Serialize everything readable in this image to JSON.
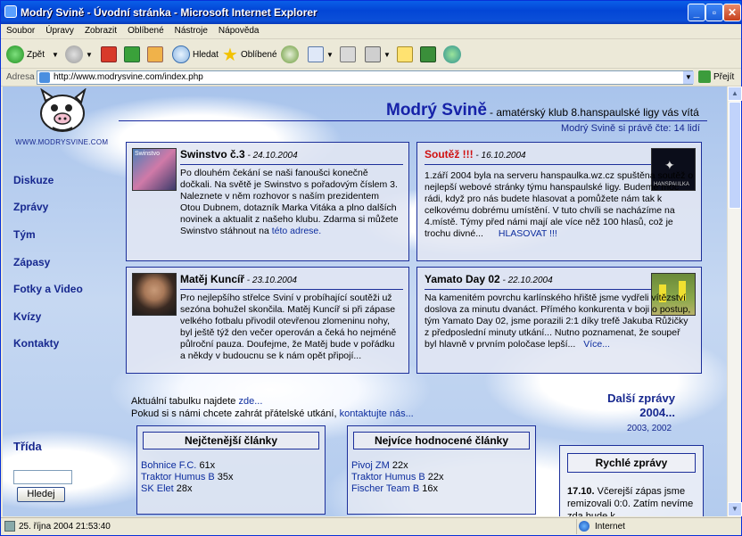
{
  "window": {
    "title": "Modrý Svině - Úvodní stránka - Microsoft Internet Explorer"
  },
  "menu": [
    "Soubor",
    "Úpravy",
    "Zobrazit",
    "Oblíbené",
    "Nástroje",
    "Nápověda"
  ],
  "toolbar": {
    "back": "Zpět",
    "search": "Hledat",
    "favorites": "Oblíbené"
  },
  "address": {
    "label": "Adresa",
    "url": "http://www.modrysvine.com/index.php",
    "go": "Přejít"
  },
  "site": {
    "logo_text": "WWW.MODRYSVINE.COM",
    "title": "Modrý Svině",
    "subtitle": "- amatérský klub 8.hanspaulské ligy vás vítá",
    "reading": "Modrý Svině si právě čte: 14 lidí"
  },
  "nav": [
    "Diskuze",
    "Zprávy",
    "Tým",
    "Zápasy",
    "Fotky a Video",
    "Kvízy",
    "Kontakty"
  ],
  "articles": [
    {
      "title": "Swinstvo č.3",
      "date": " - 24.10.2004",
      "body": "Po dlouhém čekání se naši fanoušci konečně dočkali. Na světě je Swinstvo s pořadovým číslem 3. Naleznete v něm rozhovor s naším prezidentem Otou Dubnem, dotazník Marka Vitáka a plno dalších novinek a aktualit z našeho klubu. Zdarma si můžete Swinstvo stáhnout na",
      "link": "této adrese."
    },
    {
      "title": "Soutěž !!!",
      "date": " - 16.10.2004",
      "body": "1.září 2004 byla na serveru hanspaulka.wz.cz spuštěna soutěž o nejlepší webové stránky týmu hanspaulské ligy. Budeme moc rádi, když pro nás budete hlasovat a pomůžete nám tak k celkovému dobrému umístění. V tuto chvíli se nacházíme na 4.místě. Týmy před námi mají ale více něž 100 hlasů, což je trochu divné...",
      "link": "HLASOVAT !!!"
    },
    {
      "title": "Matěj Kuncíř",
      "date": " - 23.10.2004",
      "body": "Pro nejlepšího střelce Sviní v probíhající soutěži už sezóna bohužel skončila. Matěj Kuncíř si při zápase velkého fotbalu přivodil otevřenou zlomeninu nohy, byl ještě týž den večer operován a čeká ho nejméně půlroční pauza. Doufejme, že Matěj bude v pořádku a někdy v budoucnu se k nám opět připojí...",
      "link": ""
    },
    {
      "title": "Yamato Day 02",
      "date": " - 22.10.2004",
      "body": "Na kamenitém povrchu karlínského hřiště jsme vydřeli vítězství doslova za minutu dvanáct. Přímého konkurenta v boji o postup, tým Yamato Day 02, jsme porazili 2:1 díky trefě Jakuba Růžičky z předposlední minuty utkání... Nutno poznamenat, že soupeř byl hlavně v prvním poločase lepší...",
      "link": "Více..."
    }
  ],
  "thumb_captions": {
    "swinstvo": "Swinstvo",
    "hanspaulka": "HANSPAULKA"
  },
  "middle": {
    "line1_text": "Aktuální tabulku najdete",
    "line1_link": "zde...",
    "line2_text": "Pokud si s námi chcete zahrát přátelské utkání,",
    "line2_link": "kontaktujte nás..."
  },
  "more_news": {
    "title_line1": "Další zprávy",
    "title_line2": "2004...",
    "years": "2003, 2002"
  },
  "most_read": {
    "title": "Nejčtenější články",
    "items": [
      {
        "name": "Bohnice F.C.",
        "count": "61x"
      },
      {
        "name": "Traktor Humus B",
        "count": "35x"
      },
      {
        "name": "SK Elet",
        "count": "28x"
      }
    ]
  },
  "top_rated": {
    "title": "Nejvíce hodnocené články",
    "items": [
      {
        "name": "Pivoj ZM",
        "count": "22x"
      },
      {
        "name": "Traktor Humus B",
        "count": "22x"
      },
      {
        "name": "Fischer Team B",
        "count": "16x"
      }
    ]
  },
  "trida": {
    "label": "Třída",
    "button": "Hledej"
  },
  "quick_news": {
    "title": "Rychlé zprávy",
    "date": "17.10.",
    "text": "Včerejší zápas jsme remizovali 0:0. Zatím nevíme zda bude k"
  },
  "status": {
    "text": "25. října 2004 21:53:40",
    "zone": "Internet"
  },
  "colors": {
    "accent": "#1622a8",
    "link": "#0c2c9e",
    "red": "#d01010",
    "titlebar": "#0346d6"
  }
}
